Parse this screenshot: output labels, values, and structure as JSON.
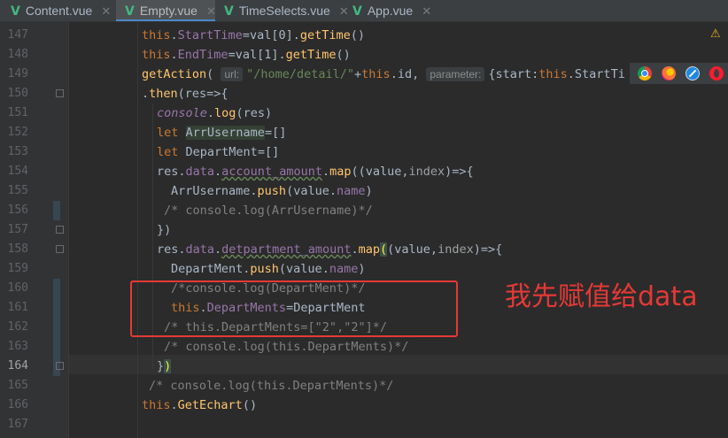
{
  "tabs": [
    {
      "label": "Content.vue",
      "active": false
    },
    {
      "label": "Empty.vue",
      "active": true
    },
    {
      "label": "TimeSelects.vue",
      "active": false
    },
    {
      "label": "App.vue",
      "active": false
    }
  ],
  "line_numbers": [
    "147",
    "148",
    "149",
    "150",
    "151",
    "152",
    "153",
    "154",
    "155",
    "156",
    "157",
    "158",
    "159",
    "160",
    "161",
    "162",
    "163",
    "164",
    "165",
    "166",
    "167"
  ],
  "current_line": "164",
  "code": {
    "l147": {
      "kw": "this",
      "rest1": ".",
      "prop": "StartTime",
      "rest2": "=val[0].",
      "fn": "getTime",
      "rest3": "()"
    },
    "l148": {
      "kw": "this",
      "rest1": ".",
      "prop": "EndTime",
      "rest2": "=val[1].",
      "fn": "getTime",
      "rest3": "()"
    },
    "l149": {
      "fn": "getAction",
      "p1": "(",
      "hint_url": "url:",
      "str": "\"/home/detail/\"",
      "plus": "+",
      "kw": "this",
      ".id": ".id,",
      "hint_param": "parameter:",
      "rest": "{start:",
      "kw2": "this",
      ".st": ".StartTi"
    },
    "l150": {
      "a": ".",
      "fn": "then",
      "b": "(res=>{"
    },
    "l151": {
      "con": "console",
      ".": ".",
      "fn": "log",
      "rest": "(res)"
    },
    "l152": {
      "kw": "let",
      "var": "ArrUsername",
      "rest": "=[]"
    },
    "l153": {
      "kw": "let",
      "var": "DepartMent",
      "rest": "=[]"
    },
    "l154": {
      "a": "res.",
      "prop1": "data",
      ".": ".",
      "prop2": "account_amount",
      "dot": ".",
      "fn": "map",
      "b": "((value,",
      "par": "index",
      "c": ")=>{"
    },
    "l155": {
      "a": "ArrUsername.",
      "fn": "push",
      "b": "(value.",
      "prop": "name",
      "c": ")"
    },
    "l156": {
      "cmt": "/* console.log(ArrUsername)*/"
    },
    "l157": {
      "a": "})"
    },
    "l158": {
      "a": "res.",
      "prop1": "data",
      ".": ".",
      "prop2": "detpartment_amount",
      "dot": ".",
      "fn": "map",
      "b": "(",
      "c": "(value,",
      "par": "index",
      "d": ")=>{"
    },
    "l159": {
      "a": "DepartMent.",
      "fn": "push",
      "b": "(value.",
      "prop": "name",
      "c": ")"
    },
    "l160": {
      "cmt": "/*console.log(DepartMent)*/"
    },
    "l161": {
      "kw": "this",
      ".": ".",
      "prop": "DepartMents",
      "rest": "=DepartMent"
    },
    "l162": {
      "cmt": "/* this.DepartMents=[\"2\",\"2\"]*/"
    },
    "l163": {
      "cmt": "/* console.log(this.DepartMents)*/"
    },
    "l164": {
      "a": "}",
      ")": ")"
    },
    "l165": {
      "cmt": "/* console.log(this.DepartMents)*/"
    },
    "l166": {
      "kw": "this",
      ".": ".",
      "fn": "GetEchart",
      "rest": "()"
    },
    "l167": {
      "a": ""
    }
  },
  "annotation": "我先赋值给data",
  "browser_icons": [
    "chrome-icon",
    "firefox-icon",
    "safari-icon",
    "opera-icon"
  ],
  "colors": {
    "keyword": "#cc7832",
    "function": "#ffc66d",
    "property": "#9876aa",
    "string": "#6a8759",
    "comment": "#808080",
    "annotation": "#e53935"
  }
}
